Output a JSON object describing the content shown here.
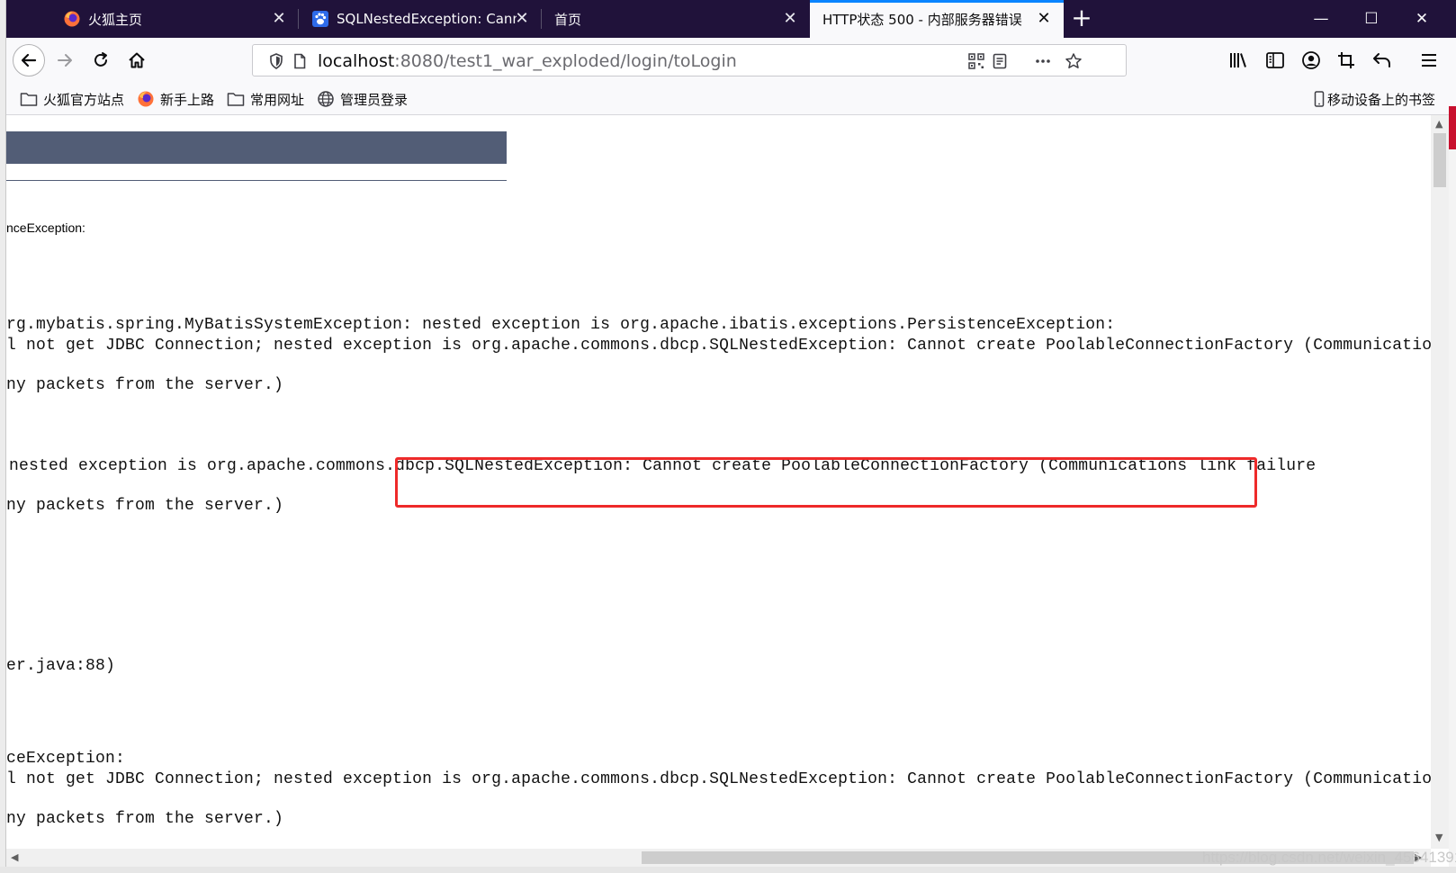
{
  "tabs": [
    {
      "title": "火狐主页",
      "icon": "firefox-icon"
    },
    {
      "title": "SQLNestedException: Canno",
      "icon": "baidu-paw-icon"
    },
    {
      "title": "首页",
      "icon": "none"
    },
    {
      "title": "HTTP状态 500 - 内部服务器错误",
      "icon": "none",
      "active": true
    }
  ],
  "window_controls": {
    "minimize": "—",
    "maximize": "☐",
    "close": "✕"
  },
  "new_tab_label": "+",
  "url": {
    "host": "localhost",
    "rest": ":8080/test1_war_exploded/login/toLogin"
  },
  "bookmarks": [
    {
      "label": "火狐官方站点",
      "icon": "folder-icon"
    },
    {
      "label": "新手上路",
      "icon": "firefox-icon"
    },
    {
      "label": "常用网址",
      "icon": "folder-icon"
    },
    {
      "label": "管理员登录",
      "icon": "globe-icon"
    }
  ],
  "mobile_bookmarks": "移动设备上的书签",
  "content": {
    "exception_label": "nceException:",
    "lines": [
      "rg.mybatis.spring.MyBatisSystemException: nested exception is org.apache.ibatis.exceptions.PersistenceException:",
      "l not get JDBC Connection; nested exception is org.apache.commons.dbcp.SQLNestedException: Cannot create PoolableConnectionFactory (Communications link failure",
      "ny packets from the server.)",
      "nested exception is org.apache.commons.dbcp.SQLNestedException: Cannot create PoolableConnectionFactory (Communications link failure",
      "ny packets from the server.)",
      "er.java:88)",
      "ceException:",
      "l not get JDBC Connection; nested exception is org.apache.commons.dbcp.SQLNestedException: Cannot create PoolableConnectionFactory (Communications link failure",
      "ny packets from the server.)"
    ]
  },
  "watermark": "https://blog.csdn.net/weixin_45641391",
  "colors": {
    "tabbar": "#20123a",
    "header": "#525d76",
    "highlight": "#ee2a2a",
    "accent": "#0a84ff"
  }
}
